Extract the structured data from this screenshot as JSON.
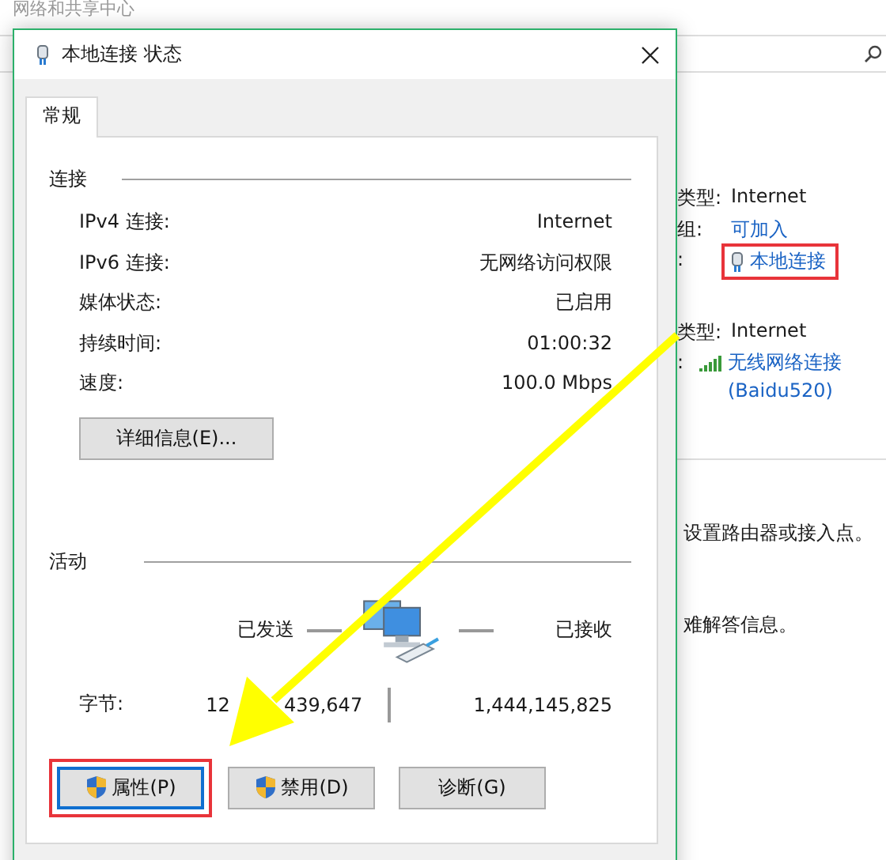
{
  "background_window": {
    "title": "网络和共享中心",
    "rows": [
      {
        "label": "类型:",
        "value": "Internet",
        "kind": "text"
      },
      {
        "label": "组:",
        "value": "可加入",
        "kind": "link"
      },
      {
        "label": ":",
        "value": "本地连接",
        "kind": "ethernet"
      },
      {
        "label": "类型:",
        "value": "Internet",
        "kind": "text"
      },
      {
        "label": ":",
        "value": "无线网络连接",
        "value_line2": "(Baidu520)",
        "kind": "wifi"
      }
    ],
    "texts": [
      "设置路由器或接入点。",
      "难解答信息。"
    ]
  },
  "dialog": {
    "title": "本地连接 状态",
    "tabs": [
      {
        "label": "常规",
        "selected": true
      }
    ],
    "connection": {
      "heading": "连接",
      "rows": [
        {
          "label": "IPv4 连接:",
          "value": "Internet"
        },
        {
          "label": "IPv6 连接:",
          "value": "无网络访问权限"
        },
        {
          "label": "媒体状态:",
          "value": "已启用"
        },
        {
          "label": "持续时间:",
          "value": "01:00:32"
        },
        {
          "label": "速度:",
          "value": "100.0 Mbps"
        }
      ],
      "details_button": "详细信息(E)..."
    },
    "activity": {
      "heading": "活动",
      "sent_label": "已发送",
      "received_label": "已接收",
      "bytes_label": "字节:",
      "bytes_sent_visible_parts": [
        "12",
        "439,647"
      ],
      "bytes_received": "1,444,145,825"
    },
    "buttons": [
      {
        "label": "属性(P)",
        "shield": true,
        "focused": true
      },
      {
        "label": "禁用(D)",
        "shield": true,
        "focused": false
      },
      {
        "label": "诊断(G)",
        "shield": false,
        "focused": false
      }
    ]
  }
}
